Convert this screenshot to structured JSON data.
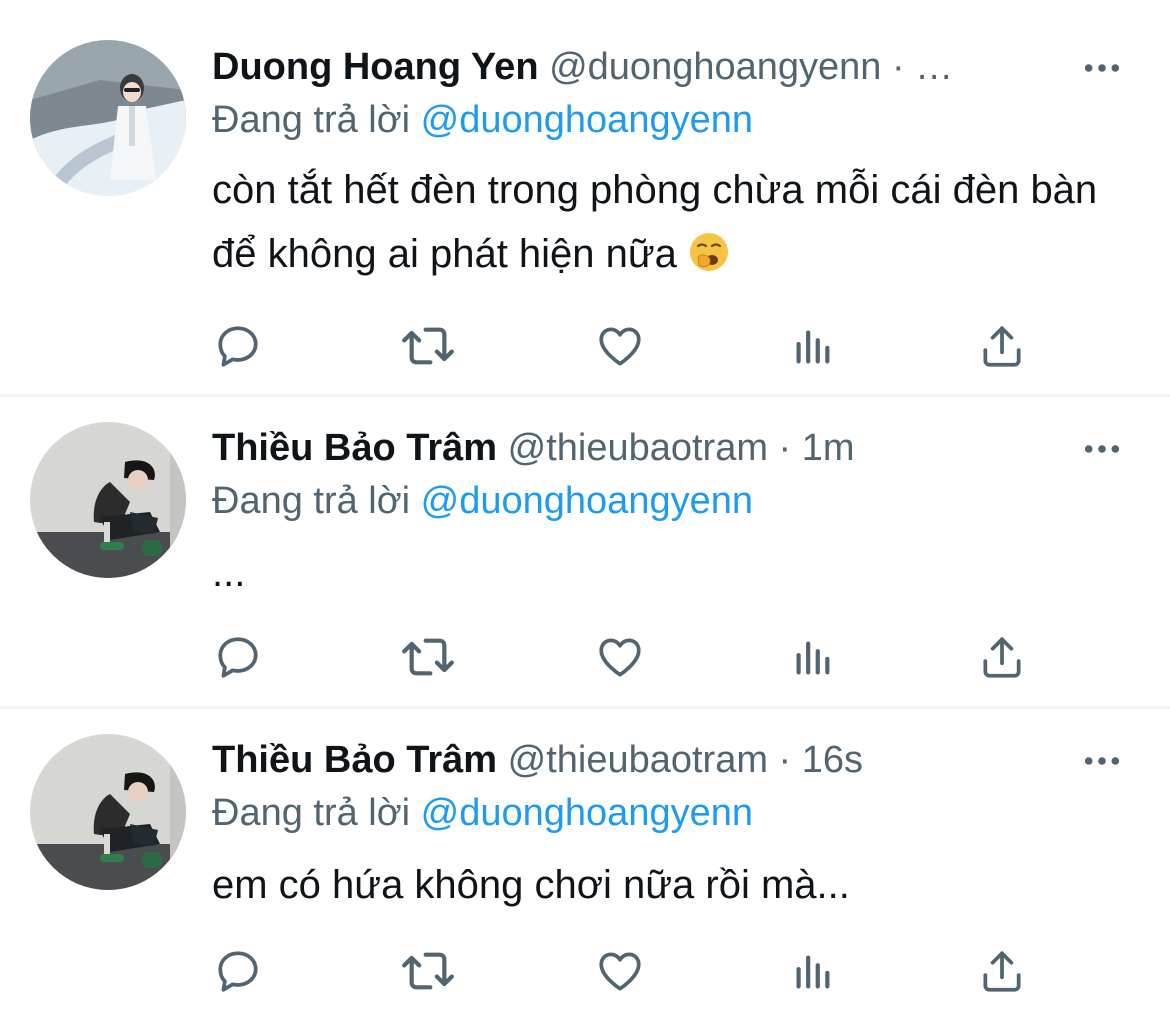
{
  "colors": {
    "text": "#0f1419",
    "secondary": "#536471",
    "accent": "#1d9bf0",
    "divider": "#eff3f4"
  },
  "tweets": [
    {
      "name": "Duong Hoang Yen",
      "handle": "@duonghoangyenn · …",
      "replying_prefix": "Đang trả lời",
      "replying_to": "@duonghoangyenn",
      "text": "còn tắt hết đèn trong phòng chừa mỗi cái đèn bàn để không ai phát hiện nữa",
      "emoji": "yawning-face"
    },
    {
      "name": "Thiều Bảo Trâm",
      "handle": "@thieubaotram · 1m",
      "replying_prefix": "Đang trả lời",
      "replying_to": "@duonghoangyenn",
      "text": "..."
    },
    {
      "name": "Thiều Bảo Trâm",
      "handle": "@thieubaotram · 16s",
      "replying_prefix": "Đang trả lời",
      "replying_to": "@duonghoangyenn",
      "text": "em có hứa không chơi nữa rồi mà..."
    }
  ],
  "icons": {
    "reply": "reply-icon",
    "retweet": "retweet-icon",
    "like": "heart-icon",
    "analytics": "analytics-icon",
    "share": "share-icon",
    "more": "more-icon"
  }
}
